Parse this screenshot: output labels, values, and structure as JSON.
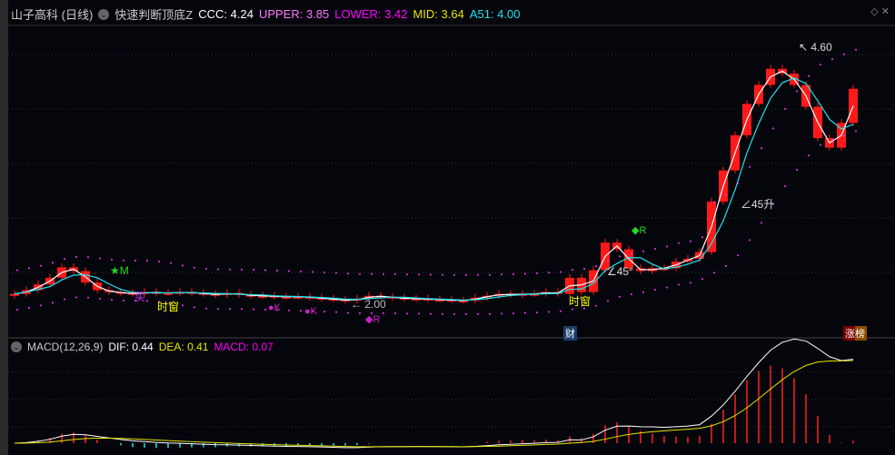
{
  "header": {
    "stock": "山子高科 (日线)",
    "indicator": "快速判断顶底Z",
    "ccc": "CCC: 4.24",
    "upper": "UPPER: 3.85",
    "lower": "LOWER: 3.42",
    "mid": "MID: 3.64",
    "a51": "A51: 4.00"
  },
  "top_icons": {
    "diamond": "◇",
    "close": "✕"
  },
  "macd_header": {
    "name": "MACD(12,26,9)",
    "dif": "DIF: 0.44",
    "dea": "DEA: 0.41",
    "macd": "MACD: 0.07"
  },
  "annotations": {
    "high": "4.60",
    "low": "2.00",
    "m": "★M",
    "buy_label": "买",
    "time_window1": "时窗",
    "time_window2": "时窗",
    "k1": "●K",
    "k2": "●K",
    "r1": "◆R",
    "r2": "◆R",
    "angle1": "∠45°",
    "angle2": "∠45升"
  },
  "badges": {
    "finance": "财",
    "rank": "涨榜"
  },
  "colors": {
    "up": "#ff1a1a",
    "ma_white": "#ffffff",
    "ma_cyan": "#19e6f0",
    "dots": "#ff33ff",
    "dif": "#ffffff",
    "dea": "#e6e600"
  },
  "chart_data": {
    "type": "candlestick",
    "closes": [
      2.08,
      2.12,
      2.18,
      2.25,
      2.36,
      2.32,
      2.2,
      2.12,
      2.1,
      2.09,
      2.08,
      2.1,
      2.09,
      2.09,
      2.1,
      2.09,
      2.08,
      2.07,
      2.09,
      2.07,
      2.06,
      2.06,
      2.05,
      2.05,
      2.05,
      2.04,
      2.03,
      2.02,
      2.01,
      2.03,
      2.06,
      2.05,
      2.04,
      2.03,
      2.03,
      2.02,
      2.02,
      2.01,
      2.01,
      2.04,
      2.06,
      2.08,
      2.07,
      2.08,
      2.08,
      2.1,
      2.08,
      2.25,
      2.1,
      2.33,
      2.62,
      2.55,
      2.35,
      2.32,
      2.35,
      2.35,
      2.42,
      2.45,
      2.52,
      3.05,
      3.38,
      3.75,
      4.08,
      4.28,
      4.45,
      4.4,
      4.28,
      4.05,
      3.72,
      3.62,
      3.88,
      4.24
    ],
    "ylim": [
      1.7,
      4.75
    ]
  }
}
